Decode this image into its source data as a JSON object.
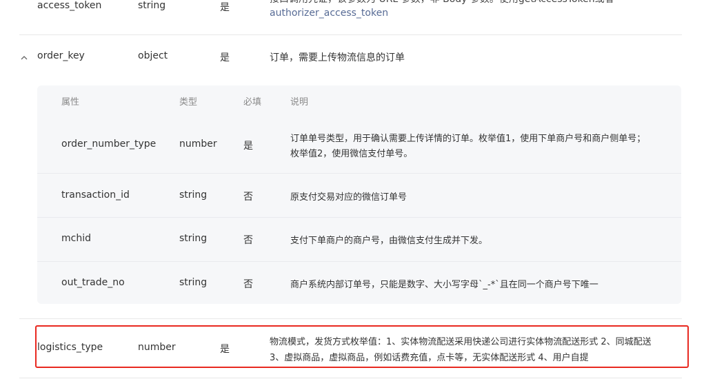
{
  "rows": {
    "access_token": {
      "name": "access_token",
      "type": "string",
      "required": "是",
      "desc_line1_partial": "接口调用凭证，该参数为 URL 参数，非 Body 参数。使用getAccessToken或者",
      "desc_line2": "authorizer_access_token"
    },
    "order_key": {
      "name": "order_key",
      "type": "object",
      "required": "是",
      "desc": "订单，需要上传物流信息的订单"
    },
    "logistics_type": {
      "name": "logistics_type",
      "type": "number",
      "required": "是",
      "desc_line1": "物流模式，发货方式枚举值：1、实体物流配送采用快递公司进行实体物流配送形式 2、同城配送",
      "desc_line2": "3、虚拟商品，虚拟商品，例如话费充值，点卡等，无实体配送形式 4、用户自提"
    }
  },
  "subtable": {
    "headers": {
      "name": "属性",
      "type": "类型",
      "required": "必填",
      "desc": "说明"
    },
    "rows": [
      {
        "name": "order_number_type",
        "type": "number",
        "required": "是",
        "desc_line1": "订单单号类型，用于确认需要上传详情的订单。枚举值1，使用下单商户号和商户侧单号；",
        "desc_line2": "枚举值2，使用微信支付单号。"
      },
      {
        "name": "transaction_id",
        "type": "string",
        "required": "否",
        "desc": "原支付交易对应的微信订单号"
      },
      {
        "name": "mchid",
        "type": "string",
        "required": "否",
        "desc": "支付下单商户的商户号，由微信支付生成并下发。"
      },
      {
        "name": "out_trade_no",
        "type": "string",
        "required": "否",
        "desc": "商户系统内部订单号，只能是数字、大小写字母`_-*`且在同一个商户号下唯一"
      }
    ]
  },
  "colors": {
    "highlight_border": "#e8281f",
    "link": "#576b95",
    "subtable_bg": "#f6f7f9"
  }
}
